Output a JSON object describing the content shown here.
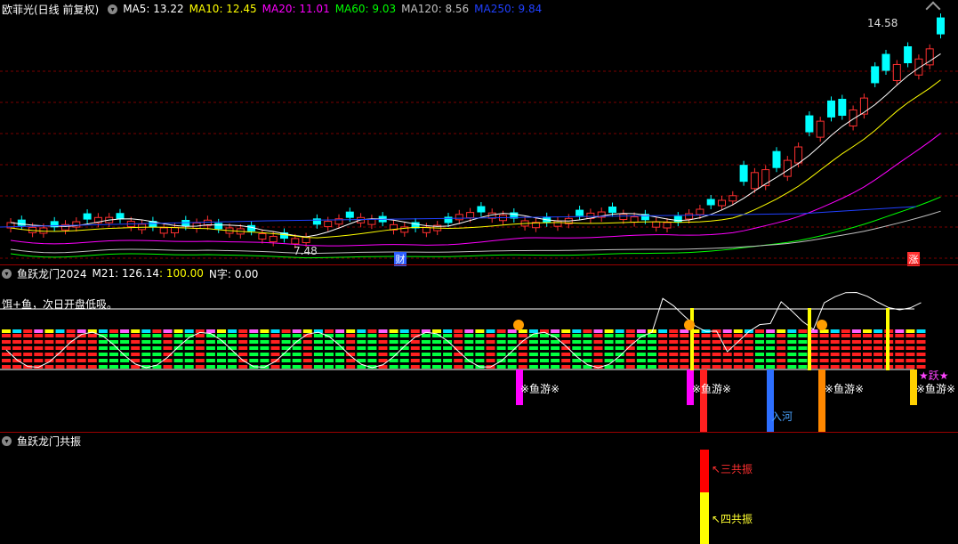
{
  "header": {
    "stock": "欧菲光(日线 前复权)",
    "ma": [
      {
        "label": "MA5: 13.22",
        "color": "#ffffff"
      },
      {
        "label": "MA10: 12.45",
        "color": "#ffff00"
      },
      {
        "label": "MA20: 11.01",
        "color": "#ff00ff"
      },
      {
        "label": "MA60: 9.03",
        "color": "#00ff00"
      },
      {
        "label": "MA120: 8.56",
        "color": "#c0c0c0"
      },
      {
        "label": "MA250: 9.84",
        "color": "#2040ff"
      }
    ]
  },
  "price_panel": {
    "high_label": "14.58",
    "low_label": "7.48",
    "marker_cai": "财",
    "marker_zhang": "涨"
  },
  "panel2": {
    "title": "鱼跃龙门2024",
    "m21": "M21: 126.14",
    "m21_val": ": 100.00",
    "n_label": "N字: 0.00",
    "note": "饵+鱼，次日开盘低吸。",
    "signal_yuyou": "※鱼游※",
    "signal_ruhe": "入河",
    "signal_yuyue": "★跃★"
  },
  "panel3": {
    "title": "鱼跃龙门共振",
    "label_three": "↖三共振",
    "label_four": "↖四共振"
  },
  "colors": {
    "up": "#ff3030",
    "down": "#00ffff",
    "separator": "#9b0000"
  }
}
